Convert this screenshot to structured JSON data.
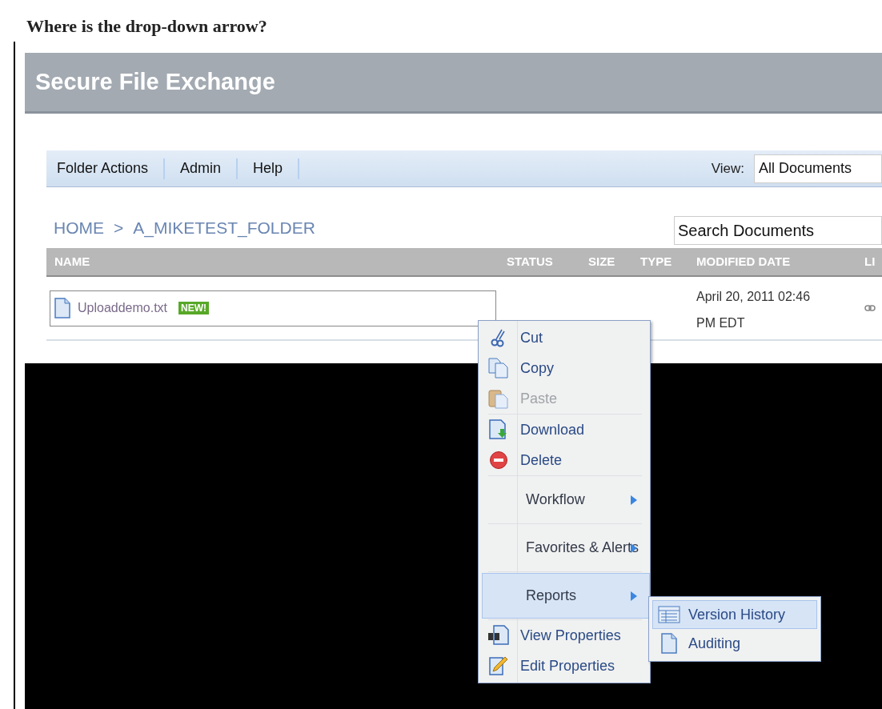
{
  "question": "Where is the drop-down arrow?",
  "app": {
    "title": "Secure File Exchange",
    "toolbar": {
      "menus": [
        "Folder Actions",
        "Admin",
        "Help"
      ],
      "view_label": "View:",
      "view_value": "All Documents"
    },
    "breadcrumb": [
      "HOME",
      ">",
      "A_MIKETEST_FOLDER"
    ],
    "search": {
      "value": "Search Documents"
    },
    "table": {
      "columns": [
        "NAME",
        "STATUS",
        "SIZE",
        "TYPE",
        "MODIFIED DATE",
        "LI"
      ],
      "rows": [
        {
          "name": "Uploaddemo.txt",
          "badge": "NEW!",
          "modified_date": [
            "April 20, 2011 02:46",
            "PM EDT"
          ]
        }
      ]
    }
  },
  "context_menu": {
    "groups": [
      {
        "items": [
          {
            "label": "Cut",
            "disabled": false,
            "highlighted": false,
            "submenu": false
          },
          {
            "label": "Copy",
            "disabled": false,
            "highlighted": false,
            "submenu": false
          },
          {
            "label": "Paste",
            "disabled": true,
            "highlighted": false,
            "submenu": false
          }
        ]
      },
      {
        "items": [
          {
            "label": "Download",
            "disabled": false,
            "highlighted": false,
            "submenu": false
          },
          {
            "label": "Delete",
            "disabled": false,
            "highlighted": false,
            "submenu": false
          }
        ]
      },
      {
        "items": [
          {
            "label": "Workflow",
            "disabled": false,
            "highlighted": false,
            "submenu": true
          }
        ]
      },
      {
        "items": [
          {
            "label": "Favorites & Alerts",
            "disabled": false,
            "highlighted": false,
            "submenu": true
          }
        ]
      },
      {
        "items": [
          {
            "label": "Reports",
            "disabled": false,
            "highlighted": true,
            "submenu": true
          }
        ]
      },
      {
        "items": [
          {
            "label": "View Properties",
            "disabled": false,
            "highlighted": false,
            "submenu": false
          },
          {
            "label": "Edit Properties",
            "disabled": false,
            "highlighted": false,
            "submenu": false
          }
        ]
      }
    ]
  },
  "submenu": {
    "items": [
      {
        "label": "Version History",
        "highlighted": true
      },
      {
        "label": "Auditing",
        "highlighted": false
      }
    ]
  }
}
